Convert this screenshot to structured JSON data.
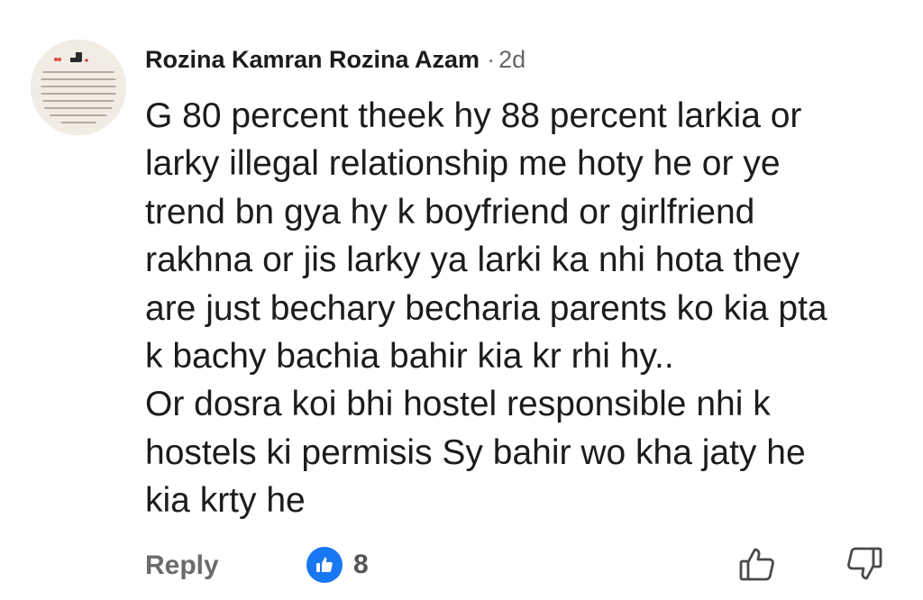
{
  "comment": {
    "author": "Rozina Kamran Rozina Azam",
    "separator": "·",
    "time": "2d",
    "lines": [
      "G 80 percent theek hy 88 percent larkia or",
      "larky illegal relationship me hoty he or ye",
      "trend bn gya hy k boyfriend or girlfriend",
      "rakhna or jis larky ya larki ka nhi hota they",
      "are just bechary becharia parents ko kia pta",
      "k bachy bachia bahir kia kr rhi hy..",
      "Or dosra koi bhi hostel responsible nhi k",
      "hostels ki permisis Sy bahir wo kha jaty he",
      "kia krty he"
    ]
  },
  "actions": {
    "reply_label": "Reply",
    "reaction_icon": "thumbs-up-reaction-icon",
    "reaction_count": "8",
    "like_icon": "thumbs-up-outline-icon",
    "dislike_icon": "thumbs-down-outline-icon"
  },
  "colors": {
    "reaction_blue": "#1877f2",
    "text_primary": "#1c1c1c",
    "text_secondary": "#6b6b6b"
  }
}
